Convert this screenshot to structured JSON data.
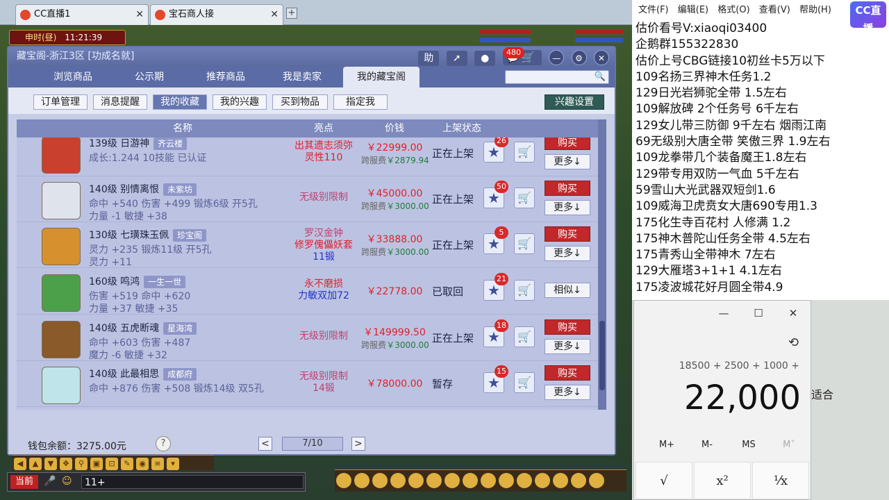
{
  "browser": {
    "tabs": [
      {
        "label": "CC直播1"
      },
      {
        "label": "宝石商人接"
      }
    ],
    "close_glyph": "✕",
    "new_tab_glyph": "+"
  },
  "game_hud": {
    "time_label": "申时(昼)",
    "time_value": "11:21:39",
    "current_channel": "当前",
    "chat_input": "11+"
  },
  "window": {
    "title": "藏宝阁-浙江3区 [功成名就]",
    "help_label": "助",
    "message_count": "480",
    "nav_tabs": [
      {
        "label": "浏览商品"
      },
      {
        "label": "公示期"
      },
      {
        "label": "推荐商品"
      },
      {
        "label": "我是卖家"
      },
      {
        "label": "我的藏宝阁"
      }
    ],
    "sub_tabs": [
      {
        "label": "订单管理"
      },
      {
        "label": "消息提醒"
      },
      {
        "label": "我的收藏"
      },
      {
        "label": "我的兴趣"
      },
      {
        "label": "买到物品"
      },
      {
        "label": "指定我"
      }
    ],
    "interest_settings": "兴趣设置",
    "columns": {
      "name": "名称",
      "highlight": "亮点",
      "price": "价钱",
      "status": "上架状态"
    },
    "rows": [
      {
        "line1": "139级 日游神",
        "server": "齐云楼",
        "line2": "成长:1.244 10技能 已认证",
        "line3": "",
        "hl1": "出其遗志须弥",
        "hl2": "灵性110",
        "hl1_color": "#e31e2a",
        "hl2_color": "#e31e2a",
        "price": "￥22999.00",
        "fee_label": "跨服费",
        "fee_value": "￥2879.94",
        "status": "正在上架",
        "favorites": "26",
        "action": "购买",
        "more": "更多↓",
        "thumb_color": "#c9402e"
      },
      {
        "line1": "140级 别情离恨",
        "server": "未紫坊",
        "line2": "命中 +540 伤害 +499 锻炼6级 开5孔",
        "line3": "力量 -1 敏捷 +38",
        "hl1": "无级别限制",
        "hl2": "",
        "hl1_color": "#c04070",
        "hl2_color": "#c04070",
        "price": "￥45000.00",
        "fee_label": "跨服费",
        "fee_value": "￥3000.00",
        "status": "正在上架",
        "favorites": "50",
        "action": "购买",
        "more": "更多↓",
        "thumb_color": "#dfe4ec"
      },
      {
        "line1": "130级 七璜珠玉佩",
        "server": "珍宝阁",
        "line2": "灵力 +235 锻炼11级 开5孔",
        "line3": "灵力 +11",
        "hl1": "罗汉金钟",
        "hl2": "修罗傀儡妖套",
        "hl3": "11锻",
        "hl1_color": "#c04070",
        "hl2_color": "#e31e2a",
        "hl3_color": "#2233cc",
        "price": "￥33888.00",
        "fee_label": "跨服费",
        "fee_value": "￥3000.00",
        "status": "正在上架",
        "favorites": "5",
        "action": "购买",
        "more": "更多↓",
        "thumb_color": "#d6902e"
      },
      {
        "line1": "160级 鸣鸿",
        "server": "一生一世",
        "line2": "伤害 +519 命中 +620",
        "line3": "力量 +37 敏捷 +35",
        "hl1": "永不磨损",
        "hl2": "力敏双加72",
        "hl1_color": "#e31e2a",
        "hl2_color": "#2233cc",
        "price": "￥22778.00",
        "fee_label": "",
        "fee_value": "",
        "status": "已取回",
        "favorites": "21",
        "action": "",
        "more": "相似↓",
        "thumb_color": "#4da04a"
      },
      {
        "line1": "140级 五虎断魂",
        "server": "星海湾",
        "line2": "命中 +603 伤害 +487",
        "line3": "魔力 -6 敏捷 +32",
        "hl1": "无级别限制",
        "hl2": "",
        "hl1_color": "#c04070",
        "hl2_color": "#c04070",
        "price": "￥149999.50",
        "fee_label": "跨服费",
        "fee_value": "￥3000.00",
        "status": "正在上架",
        "favorites": "18",
        "action": "购买",
        "more": "更多↓",
        "thumb_color": "#8a5a2a"
      },
      {
        "line1": "140级 此最相思",
        "server": "成都府",
        "line2": "命中 +876 伤害 +508 锻炼14级 双5孔",
        "line3": "",
        "hl1": "无级别限制",
        "hl2": "14锻",
        "hl1_color": "#c04070",
        "hl2_color": "#c04070",
        "price": "￥78000.00",
        "fee_label": "",
        "fee_value": "",
        "status": "暂存",
        "favorites": "15",
        "action": "购买",
        "more": "更多↓",
        "thumb_color": "#bfe4ea"
      }
    ],
    "wallet": "钱包余额：3275.00元",
    "help": "?",
    "page": "7/10",
    "prev": "<",
    "next": ">"
  },
  "notepad": {
    "menu": [
      "文件(F)",
      "编辑(E)",
      "格式(O)",
      "查看(V)",
      "帮助(H)"
    ],
    "lines": [
      "估价看号V:xiaoqi03400",
      "企鹅群155322830",
      "估价上号CBG链接10初丝卡5万以下",
      "109名扬三界神木任务1.2",
      "129日光岩狮驼全带  1.5左右",
      "109解放碑 2个任务号 6千左右",
      "129女儿带三防御 9千左右 烟雨江南",
      "69无级别大唐全带  笑傲三界 1.9左右",
      "109龙拳带几个装备魔王1.8左右",
      "129带专用双防一气血 5千左右",
      "59雪山大光武器双短剑1.6",
      "109威海卫虎贲女大唐690专用1.3",
      "175化生寺百花村 人修满 1.2",
      "175神木普陀山任务全带 4.5左右",
      "175青秀山全带神木  7左右",
      "129大雁塔3+1+1  4.1左右",
      "175凌波城花好月圆全带4.9"
    ]
  },
  "cc_logo": {
    "text": "CC直播"
  },
  "calculator": {
    "expression": "18500 + 2500 + 1000 +",
    "result": "22,000",
    "memory": [
      "M+",
      "M-",
      "MS",
      "M˅"
    ],
    "keys": [
      "√",
      "x²",
      "¹⁄x"
    ],
    "minimize": "—",
    "maximize": "☐",
    "close": "✕",
    "history": "⟲"
  },
  "side_text": [
    "适合"
  ]
}
